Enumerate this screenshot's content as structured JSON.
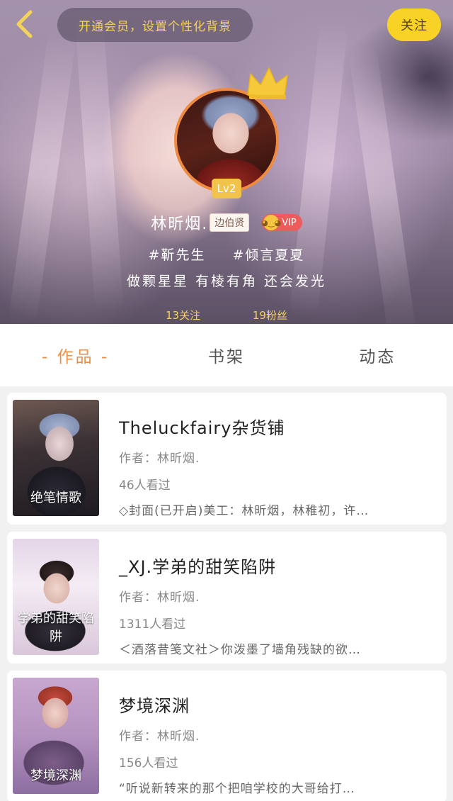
{
  "header": {
    "vip_prompt": "开通会员，设置个性化背景",
    "follow_label": "关注"
  },
  "profile": {
    "level": "Lv2",
    "username": "林昕烟.",
    "name_tag": "边伯贤",
    "vip_label": "VIP",
    "tags": "#靳先生 #倾言夏夏",
    "bio": "做颗星星 有棱有角 还会发光",
    "following": "13关注",
    "followers": "19粉丝"
  },
  "tabs": [
    {
      "label": "- 作品 -",
      "active": true
    },
    {
      "label": "书架",
      "active": false
    },
    {
      "label": "动态",
      "active": false
    }
  ],
  "works": [
    {
      "title": "Theluckfairy杂货铺",
      "author": "作者：林昕烟.",
      "views": "46人看过",
      "desc": "◇封面(已开启)美工：林昕烟，林稚初，许…",
      "cover_text": "绝笔情歌"
    },
    {
      "title": "_XJ.学弟的甜笑陷阱",
      "author": "作者：林昕烟.",
      "views": "1311人看过",
      "desc": "＜酒落昔笺文社＞你泼墨了墙角残缺的欲…",
      "cover_text": "学弟的甜笑陷阱"
    },
    {
      "title": "梦境深渊",
      "author": "作者：林昕烟.",
      "views": "156人看过",
      "desc": "“听说新转来的那个把咱学校的大哥给打…",
      "cover_text": "梦境深渊"
    }
  ],
  "colors": {
    "accent": "#ee8e43",
    "follow_bg": "#f8d224",
    "gold_text": "#f5d35b",
    "vip_badge": "#ec5c5c"
  },
  "icons": {
    "back": "chevron-left-icon",
    "crown": "crown-icon",
    "vip": "vip-face-icon"
  }
}
